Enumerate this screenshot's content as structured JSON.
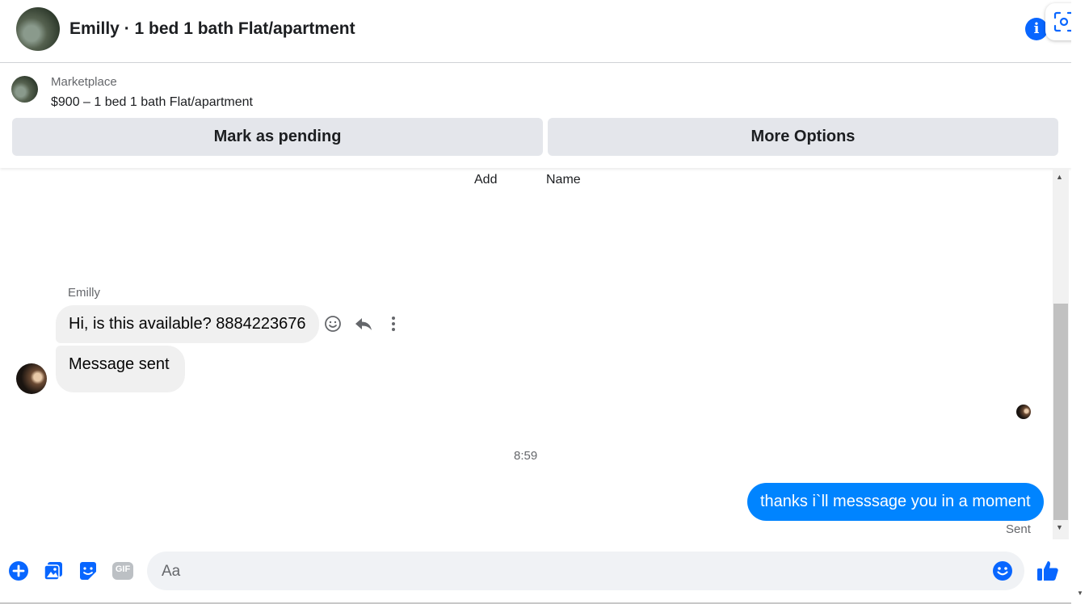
{
  "header": {
    "title": "Emilly · 1 bed 1 bath Flat/apartment",
    "info_icon": "info-icon",
    "screen_icon": "screenshot-icon"
  },
  "listing": {
    "source": "Marketplace",
    "price_title": "$900 – 1 bed 1 bath Flat/apartment",
    "mark_pending_label": "Mark as pending",
    "more_options_label": "More Options"
  },
  "chat": {
    "top_labels": [
      "Add",
      "Name"
    ],
    "sender_name": "Emilly",
    "incoming": [
      {
        "text": "Hi, is this available? 8884223676"
      },
      {
        "text": "Message sent"
      }
    ],
    "timestamp": "8:59",
    "outgoing": [
      {
        "text": "thanks i`ll messsage you in a moment",
        "status": "Sent"
      }
    ],
    "message_actions": [
      "react-icon",
      "reply-icon",
      "more-icon"
    ]
  },
  "composer": {
    "placeholder": "Aa",
    "icons": [
      "plus-icon",
      "photo-icon",
      "sticker-icon",
      "gif-icon",
      "emoji-icon",
      "like-icon"
    ],
    "gif_label": "GIF"
  },
  "colors": {
    "accent": "#0866ff",
    "outgoing_bubble": "#0084ff",
    "incoming_bubble": "#f0f0f0",
    "button_bg": "#e4e6eb"
  }
}
